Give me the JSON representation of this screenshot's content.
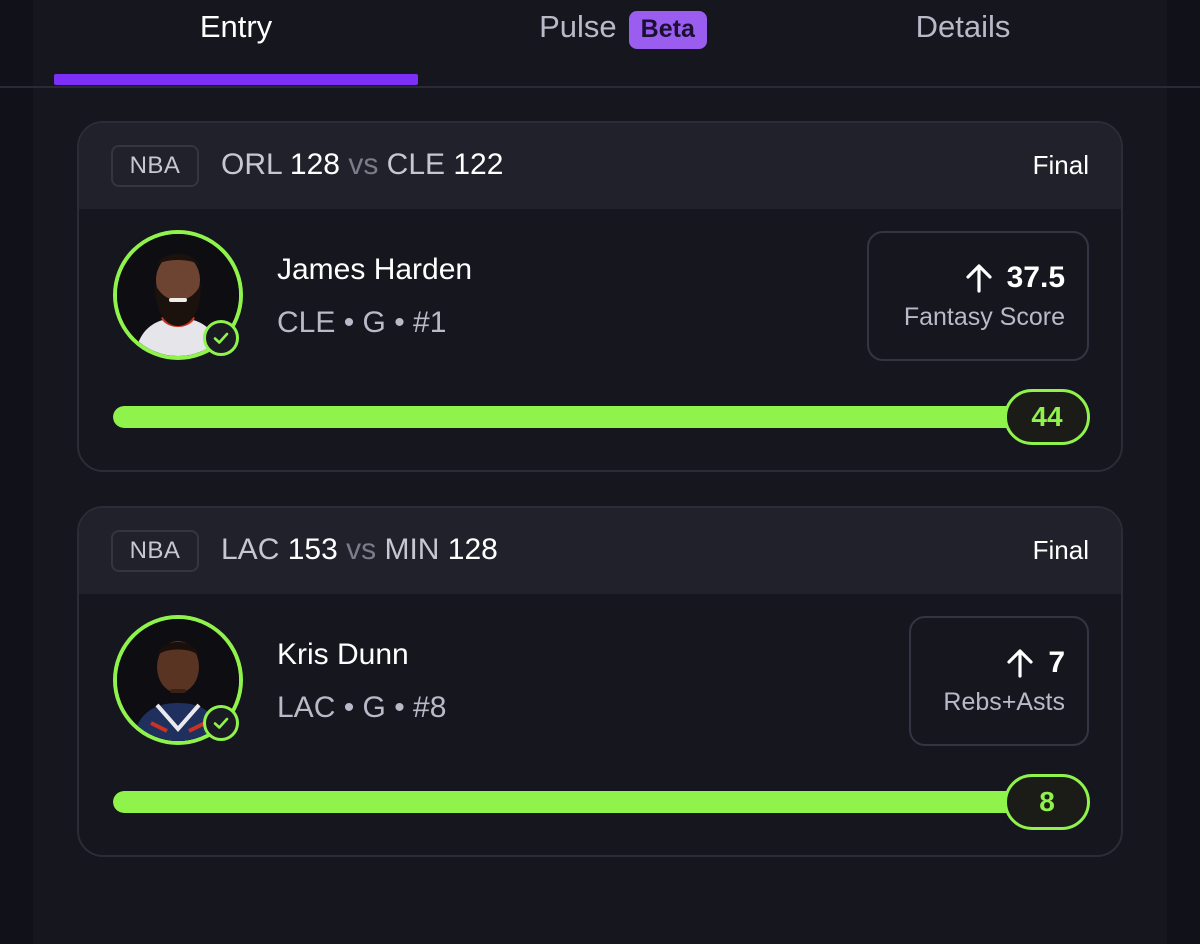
{
  "tabs": [
    {
      "label": "Entry",
      "active": true
    },
    {
      "label": "Pulse",
      "badge": "Beta",
      "active": false
    },
    {
      "label": "Details",
      "active": false
    }
  ],
  "colors": {
    "accent": "#7b2ff7",
    "success": "#8ff34b",
    "beta_badge": "#9b5cf0"
  },
  "cards": [
    {
      "league": "NBA",
      "team1": "ORL",
      "score1": "128",
      "vs": "vs",
      "team2": "CLE",
      "score2": "122",
      "status": "Final",
      "player_name": "James Harden",
      "player_meta": "CLE • G • #1",
      "avatar_icon": "player-headshot-icon",
      "stat_value": "37.5",
      "stat_label": "Fantasy Score",
      "stat_icon": "arrow-up-icon",
      "result_value": "44",
      "progress_fraction": 1.0
    },
    {
      "league": "NBA",
      "team1": "LAC",
      "score1": "153",
      "vs": "vs",
      "team2": "MIN",
      "score2": "128",
      "status": "Final",
      "player_name": "Kris Dunn",
      "player_meta": "LAC • G • #8",
      "avatar_icon": "player-headshot-icon",
      "stat_value": "7",
      "stat_label": "Rebs+Asts",
      "stat_icon": "arrow-up-icon",
      "result_value": "8",
      "progress_fraction": 1.0
    }
  ]
}
